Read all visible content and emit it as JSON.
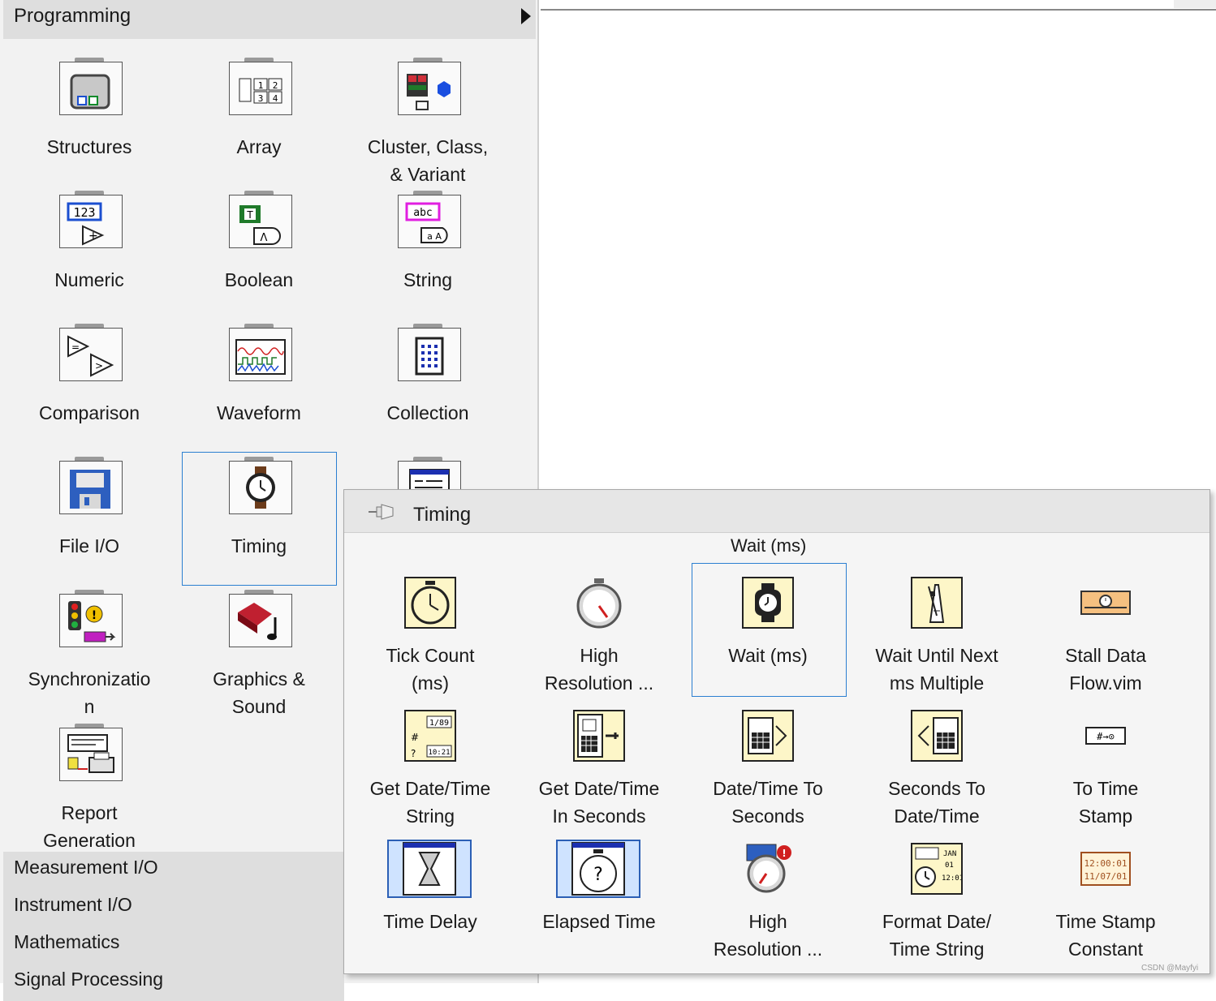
{
  "programming": {
    "header": "Programming",
    "categories": [
      {
        "label": "Structures",
        "icon": "structures-icon"
      },
      {
        "label": "Array",
        "icon": "array-icon"
      },
      {
        "label": "Cluster, Class,\n& Variant",
        "icon": "cluster-icon"
      },
      {
        "label": "Numeric",
        "icon": "numeric-icon"
      },
      {
        "label": "Boolean",
        "icon": "boolean-icon"
      },
      {
        "label": "String",
        "icon": "string-icon"
      },
      {
        "label": "Comparison",
        "icon": "comparison-icon"
      },
      {
        "label": "Waveform",
        "icon": "waveform-icon"
      },
      {
        "label": "Collection",
        "icon": "collection-icon"
      },
      {
        "label": "File I/O",
        "icon": "file-io-icon"
      },
      {
        "label": "Timing",
        "icon": "timing-icon"
      },
      {
        "label": "Synchronizatio\nn",
        "icon": "synchronization-icon"
      },
      {
        "label": "Graphics &\nSound",
        "icon": "graphics-sound-icon"
      },
      {
        "label": "Report\nGeneration",
        "icon": "report-generation-icon"
      }
    ],
    "other_palettes": [
      "Measurement I/O",
      "Instrument I/O",
      "Mathematics",
      "Signal Processing"
    ]
  },
  "timing": {
    "title": "Timing",
    "hover_label": "Wait (ms)",
    "functions": [
      {
        "label": "Tick Count\n(ms)",
        "icon": "tick-count-icon"
      },
      {
        "label": "High\nResolution ...",
        "icon": "high-resolution-stopwatch-icon"
      },
      {
        "label": "Wait (ms)",
        "icon": "wait-ms-icon"
      },
      {
        "label": "Wait Until Next\nms Multiple",
        "icon": "metronome-icon"
      },
      {
        "label": "Stall Data\nFlow.vim",
        "icon": "stall-data-flow-icon"
      },
      {
        "label": "Get Date/Time\nString",
        "icon": "get-date-time-string-icon"
      },
      {
        "label": "Get Date/Time\nIn Seconds",
        "icon": "get-date-time-seconds-icon"
      },
      {
        "label": "Date/Time To\nSeconds",
        "icon": "date-time-to-seconds-icon"
      },
      {
        "label": "Seconds To\nDate/Time",
        "icon": "seconds-to-date-time-icon"
      },
      {
        "label": "To Time\nStamp",
        "icon": "to-time-stamp-icon"
      },
      {
        "label": "Time Delay",
        "icon": "hourglass-icon"
      },
      {
        "label": "Elapsed Time",
        "icon": "elapsed-time-icon"
      },
      {
        "label": "High\nResolution ...",
        "icon": "high-resolution-polling-wait-icon"
      },
      {
        "label": "Format Date/\nTime String",
        "icon": "format-date-time-icon"
      },
      {
        "label": "Time Stamp\nConstant",
        "icon": "time-stamp-constant-icon"
      }
    ],
    "icon_text": {
      "numeric_display": "123",
      "string_display": "abc",
      "get_dt_top": "1/89",
      "get_dt_bottom": "10:21",
      "to_ts": "#→⊙",
      "ts_line1": "12:00:01",
      "ts_line2": "11/07/01",
      "fmt_month": "JAN",
      "fmt_day": "01",
      "fmt_time": "12:01"
    }
  },
  "watermark": "CSDN @Mayfyi"
}
